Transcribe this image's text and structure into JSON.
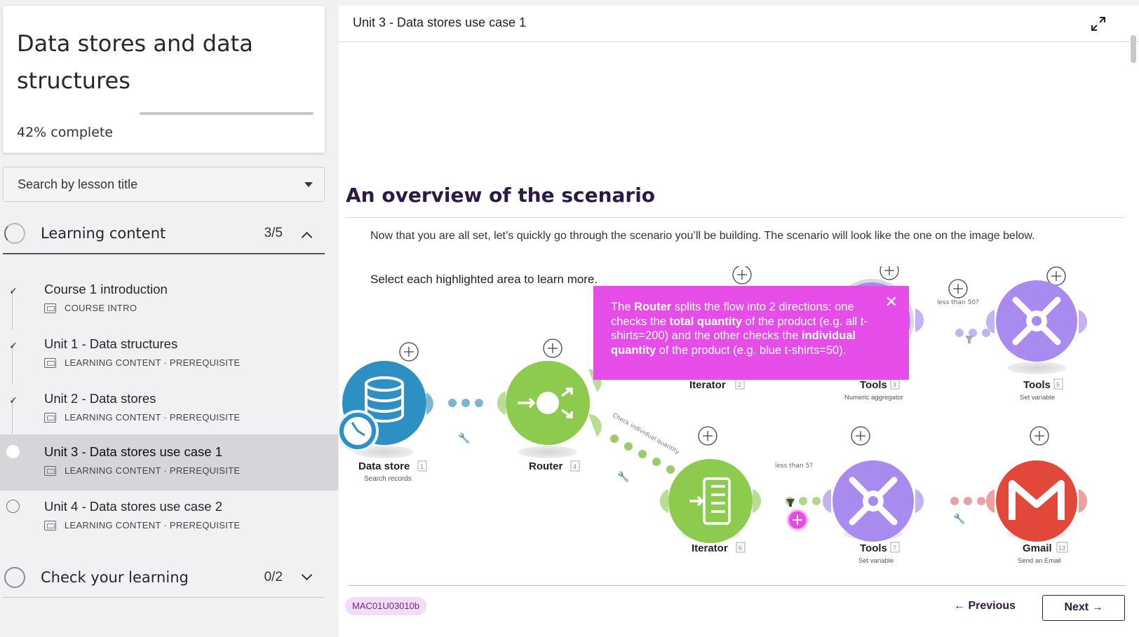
{
  "course": {
    "title": "Data stores and data structures",
    "progress_percent": 42,
    "progress_value": "42%",
    "progress_suffix": " complete"
  },
  "search": {
    "placeholder": "Search by lesson title"
  },
  "sections": [
    {
      "label": "Learning content",
      "count": "3/5",
      "expanded": true,
      "lessons": [
        {
          "title": "Course 1 introduction",
          "meta": "COURSE INTRO",
          "done": true
        },
        {
          "title": "Unit 1 - Data structures",
          "meta": "LEARNING CONTENT · PREREQUISITE",
          "done": true
        },
        {
          "title": "Unit 2 - Data stores",
          "meta": "LEARNING CONTENT · PREREQUISITE",
          "done": true
        },
        {
          "title": "Unit 3 - Data stores use case 1",
          "meta": "LEARNING CONTENT · PREREQUISITE",
          "done": false,
          "active": true
        },
        {
          "title": "Unit 4 - Data stores use case 2",
          "meta": "LEARNING CONTENT · PREREQUISITE",
          "done": false
        }
      ]
    },
    {
      "label": "Check your learning",
      "count": "0/2",
      "expanded": false
    }
  ],
  "main": {
    "header_title": "Unit 3 - Data stores use case 1",
    "heading": "An overview of the scenario",
    "paragraph": "Now that you are all set, let’s quickly go through the scenario you’ll be building. The scenario will look like the one on the image below.",
    "hint": "Select each highlighted area to learn more.",
    "lesson_code": "MAC01U03010b",
    "prev_label": "← Previous",
    "next_label": "Next →"
  },
  "tooltip": {
    "t1": "The ",
    "b1": "Router",
    "t2": " splits the flow into 2 directions: one checks the ",
    "b2": "total quantity",
    "t3": " of the product (e.g. all t-shirts=200) and the other checks the ",
    "b3": "individual quantity",
    "t4": " of the product (e.g. blue t-shirts=50)."
  },
  "diagram": {
    "nodes": [
      {
        "name": "Data store",
        "num": "1",
        "sub": "Search records",
        "color": "#2e8fc2"
      },
      {
        "name": "Router",
        "num": "4",
        "sub": "",
        "color": "#8ccb4e"
      },
      {
        "name": "Iterator",
        "num": "2",
        "sub": "",
        "color": "#8ccb4e"
      },
      {
        "name": "Tools",
        "num": "3",
        "sub": "Numeric aggregator",
        "color": "#a98bf0"
      },
      {
        "name": "Tools",
        "num": "5",
        "sub": "Set variable",
        "color": "#a98bf0"
      },
      {
        "name": "Iterator",
        "num": "6",
        "sub": "",
        "color": "#8ccb4e"
      },
      {
        "name": "Tools",
        "num": "7",
        "sub": "Set variable",
        "color": "#a98bf0"
      },
      {
        "name": "Gmail",
        "num": "13",
        "sub": "Send an Email",
        "color": "#e2483a"
      }
    ],
    "filter_labels": [
      "less than 50?",
      "less than 5?",
      "Check individual quantity"
    ]
  },
  "colors": {
    "tooltip_bg": "#e64ce8",
    "heading": "#2a1a45",
    "tools_purple": "#a98bf0",
    "router_green": "#8ccb4e",
    "datastore_blue": "#2e8fc2",
    "gmail_red": "#e2483a"
  }
}
